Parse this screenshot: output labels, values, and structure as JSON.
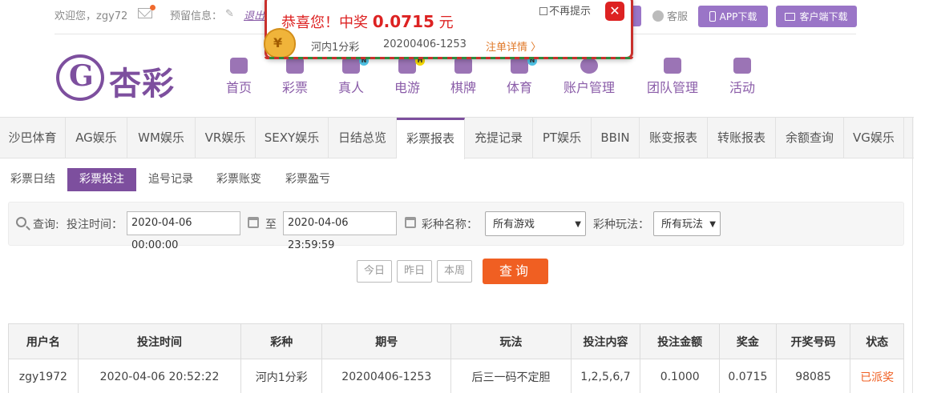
{
  "topbar": {
    "welcome": "欢迎您，zgy72",
    "reserve_info": "预留信息：",
    "logout": "退出",
    "customer_service": "客服",
    "app_download": "APP下载",
    "client_download": "客户端下载"
  },
  "logo": {
    "text": "杏彩"
  },
  "main_nav": [
    {
      "label": "首页",
      "icon": "home-icon"
    },
    {
      "label": "彩票",
      "icon": "ticket-icon"
    },
    {
      "label": "真人",
      "icon": "dealer-icon",
      "badge": "N"
    },
    {
      "label": "电游",
      "icon": "gamepad-icon",
      "badge": "H"
    },
    {
      "label": "棋牌",
      "icon": "cards-icon"
    },
    {
      "label": "体育",
      "icon": "trophy-icon",
      "badge": "N"
    },
    {
      "label": "账户管理",
      "icon": "yen-icon"
    },
    {
      "label": "团队管理",
      "icon": "team-icon"
    },
    {
      "label": "活动",
      "icon": "gift-icon"
    }
  ],
  "tabs": [
    {
      "label": "沙巴体育"
    },
    {
      "label": "AG娱乐"
    },
    {
      "label": "WM娱乐"
    },
    {
      "label": "VR娱乐"
    },
    {
      "label": "SEXY娱乐"
    },
    {
      "label": "日结总览"
    },
    {
      "label": "彩票报表",
      "active": true
    },
    {
      "label": "充提记录"
    },
    {
      "label": "PT娱乐"
    },
    {
      "label": "BBIN"
    },
    {
      "label": "账变报表"
    },
    {
      "label": "转账报表"
    },
    {
      "label": "余额查询"
    },
    {
      "label": "VG娱乐"
    }
  ],
  "sub_tabs": [
    {
      "label": "彩票日结"
    },
    {
      "label": "彩票投注",
      "active": true
    },
    {
      "label": "追号记录"
    },
    {
      "label": "彩票账变"
    },
    {
      "label": "彩票盈亏"
    }
  ],
  "query": {
    "label": "查询:",
    "bet_time_label": "投注时间：",
    "start_time": "2020-04-06 00:00:00",
    "to_label": "至",
    "end_time": "2020-04-06 23:59:59",
    "game_name_label": "彩种名称：",
    "game_name_value": "所有游戏",
    "play_label": "彩种玩法：",
    "play_value": "所有玩法",
    "today": "今日",
    "yesterday": "昨日",
    "this_week": "本周",
    "submit": "查询"
  },
  "table": {
    "headers": [
      "用户名",
      "投注时间",
      "彩种",
      "期号",
      "玩法",
      "投注内容",
      "投注金额",
      "奖金",
      "开奖号码",
      "状态"
    ],
    "rows": [
      [
        "zgy1972",
        "2020-04-06 20:52:22",
        "河内1分彩",
        "20200406-1253",
        "后三一码不定胆",
        "1,2,5,6,7",
        "0.1000",
        "0.0715",
        "98085",
        "已派奖"
      ]
    ]
  },
  "popup": {
    "title_prefix": "恭喜您！中奖 ",
    "amount": "0.0715",
    "unit": " 元",
    "game": "河内1分彩",
    "issue": "20200406-1253",
    "detail_link": "注单详情 〉",
    "no_more_label": "不再提示",
    "close": "✕"
  },
  "colors": {
    "brand_purple": "#7d4f9e",
    "button_purple": "#9a75c7",
    "accent_orange": "#f05f22",
    "popup_red": "#d22222"
  }
}
